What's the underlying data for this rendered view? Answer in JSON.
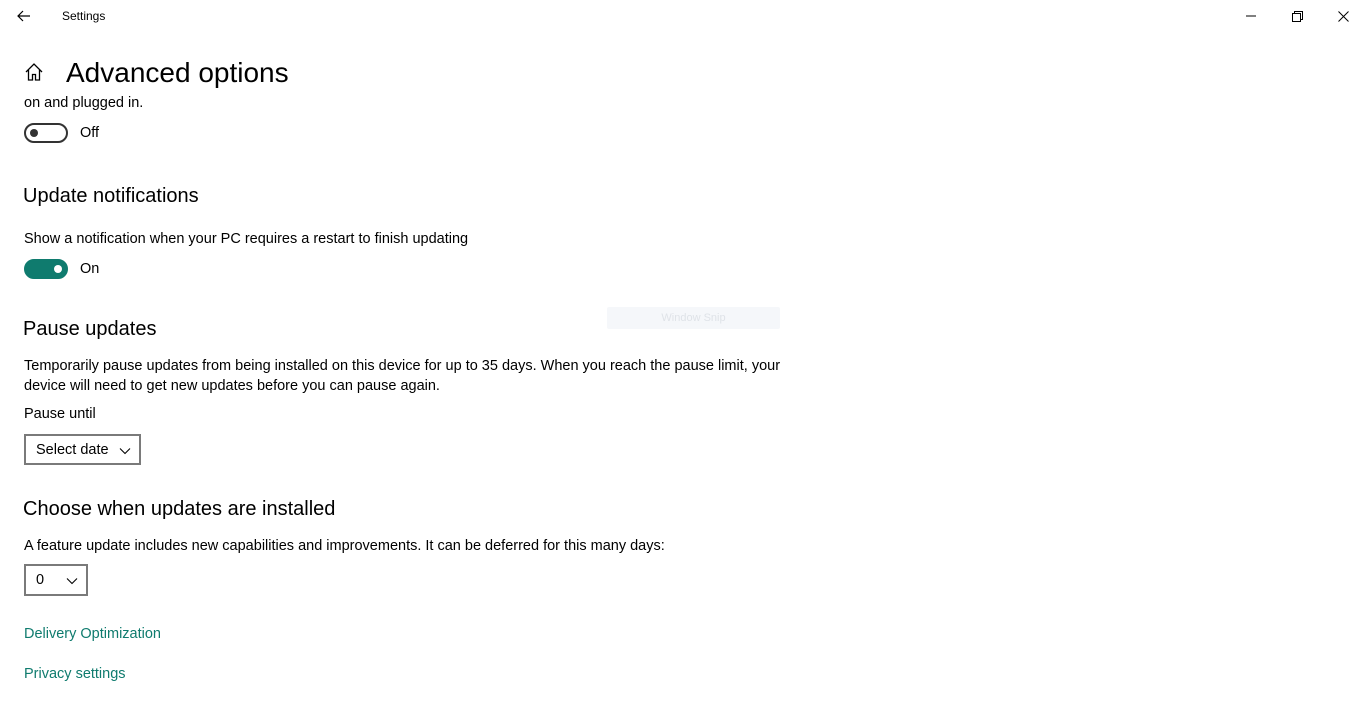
{
  "window": {
    "title": "Settings"
  },
  "header": {
    "title": "Advanced options"
  },
  "top_section": {
    "cutoff_text": "on and plugged in.",
    "toggle_state": "Off"
  },
  "update_notifications": {
    "title": "Update notifications",
    "description": "Show a notification when your PC requires a restart to finish updating",
    "toggle_state": "On"
  },
  "pause_updates": {
    "title": "Pause updates",
    "description_line1": "Temporarily pause updates from being installed on this device for up to 35 days. When you reach the pause limit, your",
    "description_line2": "device will need to get new updates before you can pause again.",
    "pause_until_label": "Pause until",
    "select_value": "Select date"
  },
  "choose_updates": {
    "title": "Choose when updates are installed",
    "description": "A feature update includes new capabilities and improvements. It can be deferred for this many days:",
    "defer_value": "0"
  },
  "links": {
    "delivery_optimization": "Delivery Optimization",
    "privacy_settings": "Privacy settings"
  },
  "overlay": {
    "text": "Window Snip"
  },
  "colors": {
    "accent": "#0f7b6e"
  }
}
